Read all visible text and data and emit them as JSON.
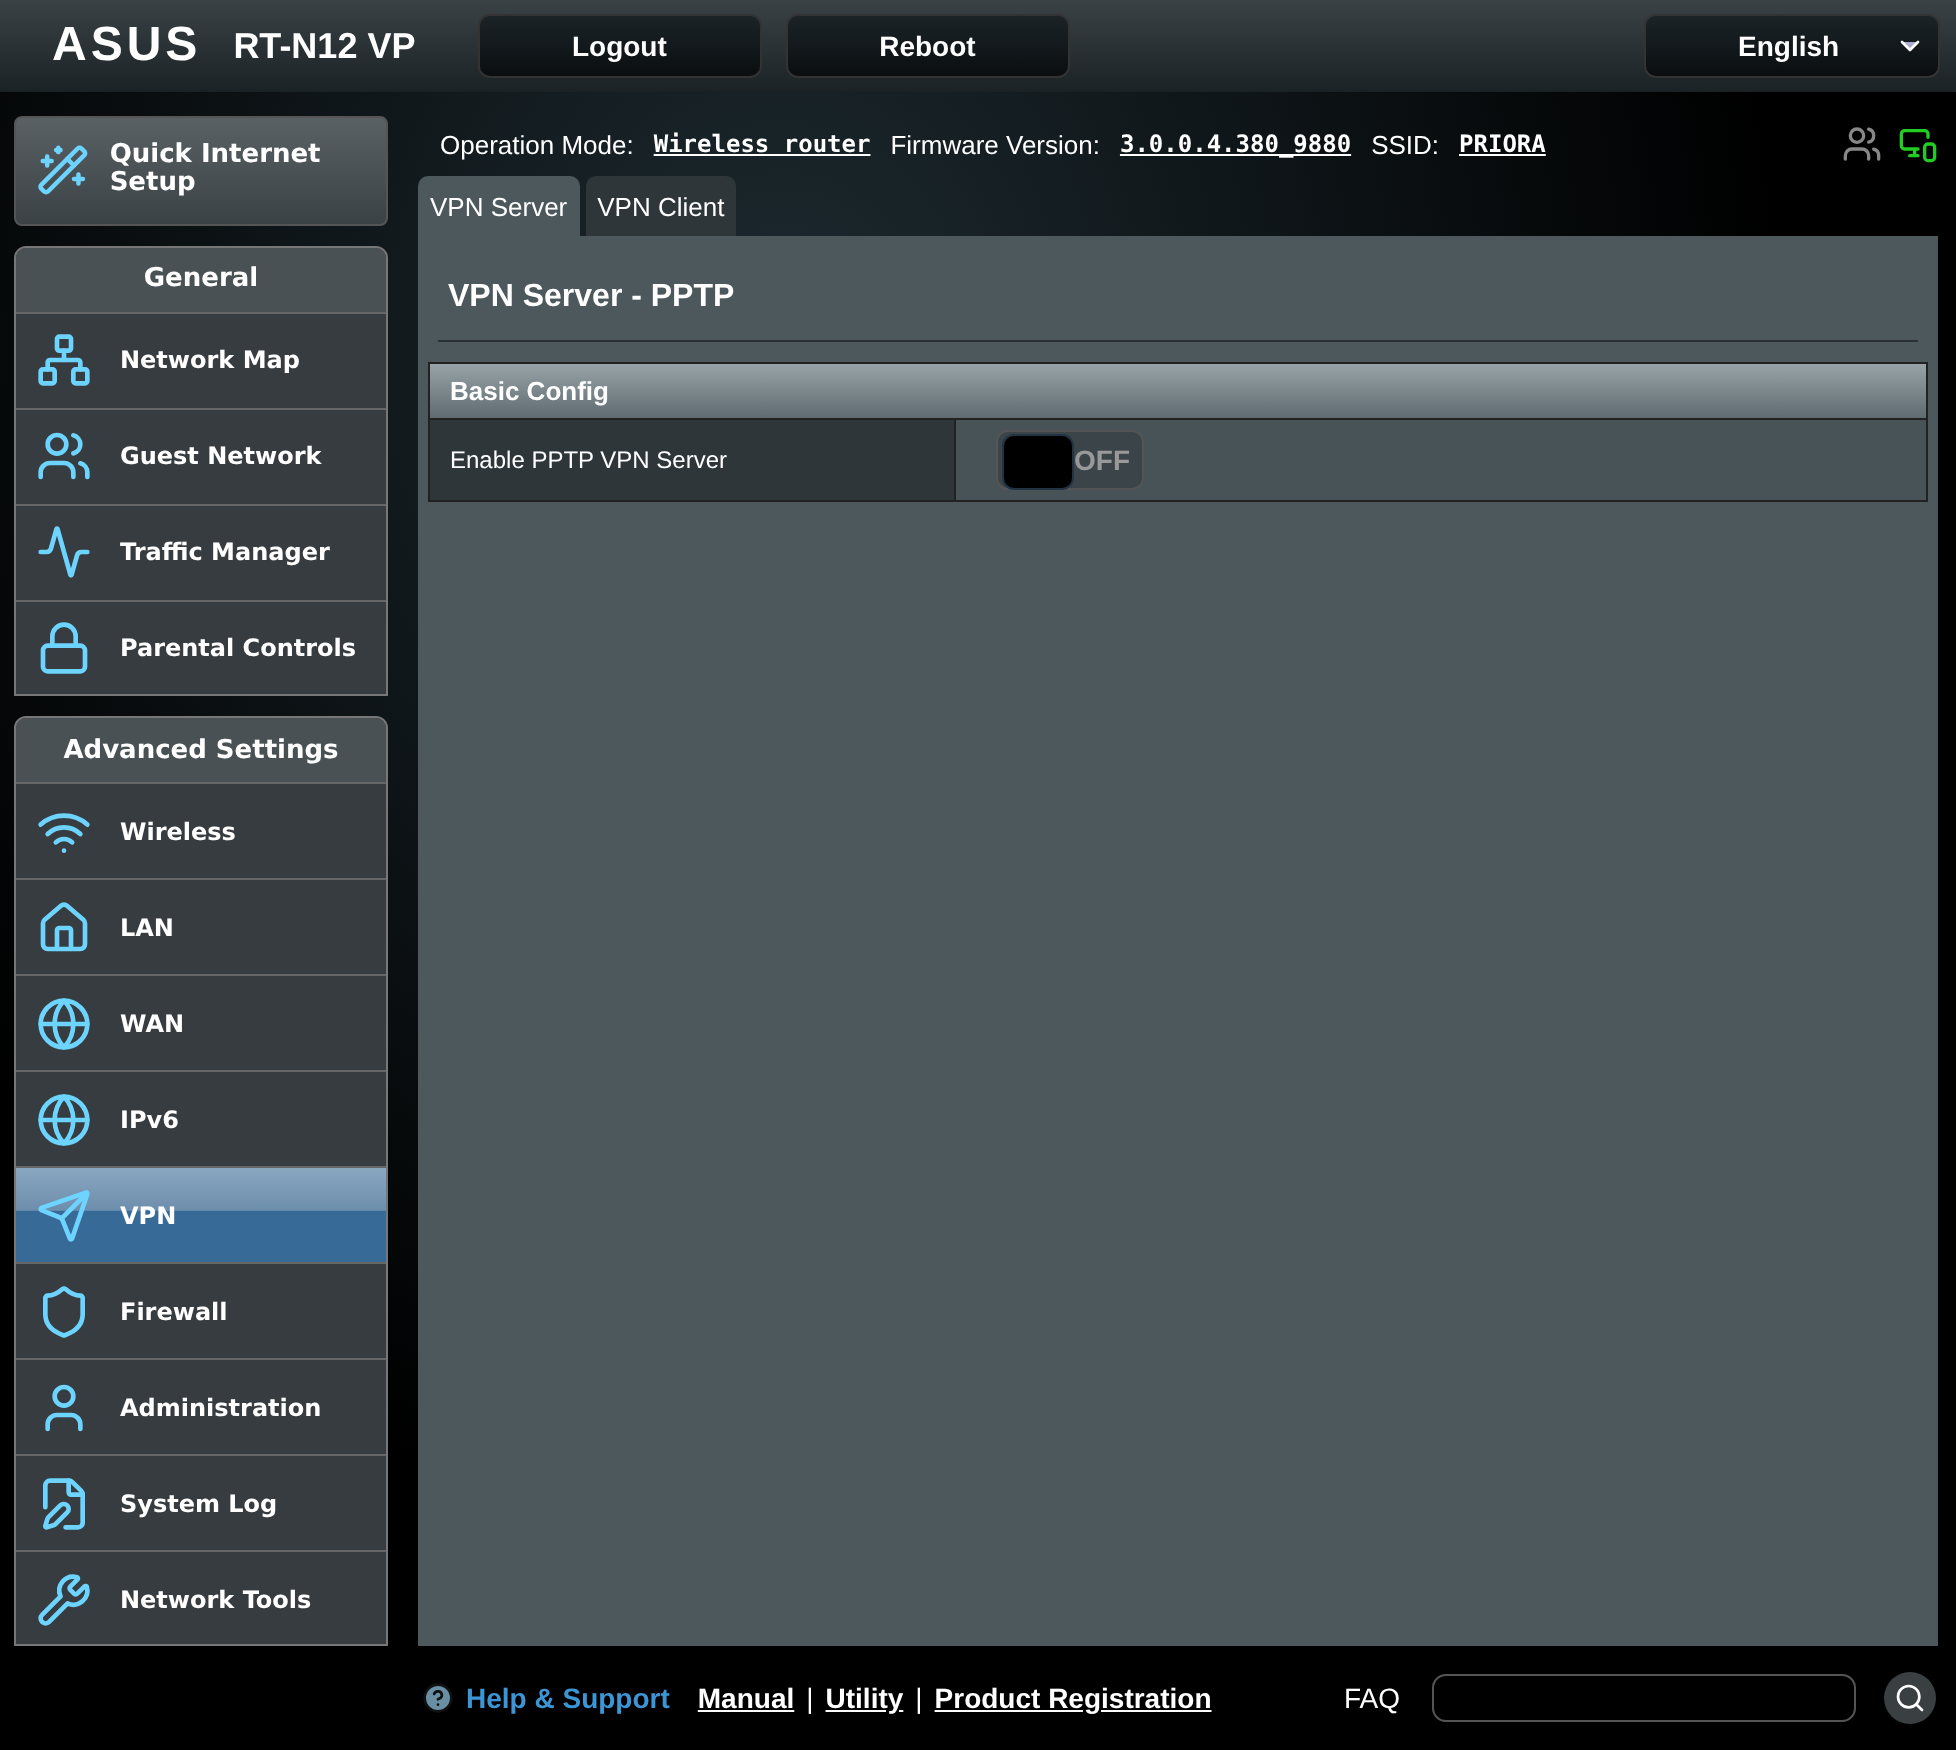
{
  "header": {
    "logo": "ASUS",
    "model": "RT-N12 VP",
    "buttons": [
      "Logout",
      "Reboot"
    ],
    "language": {
      "value": "English"
    }
  },
  "status_line": [
    {
      "label": "Operation Mode:",
      "value": "Wireless router"
    },
    {
      "label": "Firmware Version:",
      "value": "3.0.0.4.380_9880"
    },
    {
      "label": "SSID:",
      "value": "PRIORA"
    }
  ],
  "quick_setup": {
    "label": "Quick Internet Setup"
  },
  "sidebar": [
    {
      "title": "General",
      "items": [
        {
          "label": "Network Map",
          "selected": false
        },
        {
          "label": "Guest Network",
          "selected": false
        },
        {
          "label": "Traffic Manager",
          "selected": false
        },
        {
          "label": "Parental Controls",
          "selected": false
        }
      ]
    },
    {
      "title": "Advanced Settings",
      "items": [
        {
          "label": "Wireless",
          "selected": false
        },
        {
          "label": "LAN",
          "selected": false
        },
        {
          "label": "WAN",
          "selected": false
        },
        {
          "label": "IPv6",
          "selected": false
        },
        {
          "label": "VPN",
          "selected": true
        },
        {
          "label": "Firewall",
          "selected": false
        },
        {
          "label": "Administration",
          "selected": false
        },
        {
          "label": "System Log",
          "selected": false
        },
        {
          "label": "Network Tools",
          "selected": false
        }
      ]
    }
  ],
  "tabs": [
    {
      "label": "VPN Server",
      "selected": true
    },
    {
      "label": "VPN Client",
      "selected": false
    }
  ],
  "page_title": "VPN Server - PPTP",
  "table": {
    "header": "Basic Config",
    "rows": [
      {
        "label": "Enable PPTP VPN Server",
        "toggle": {
          "on": false,
          "text": "OFF"
        }
      }
    ]
  },
  "footer": {
    "help": "Help & Support",
    "links": [
      "Manual",
      "Utility",
      "Product Registration"
    ],
    "separators": [
      "|",
      "|"
    ],
    "faq": "FAQ"
  }
}
